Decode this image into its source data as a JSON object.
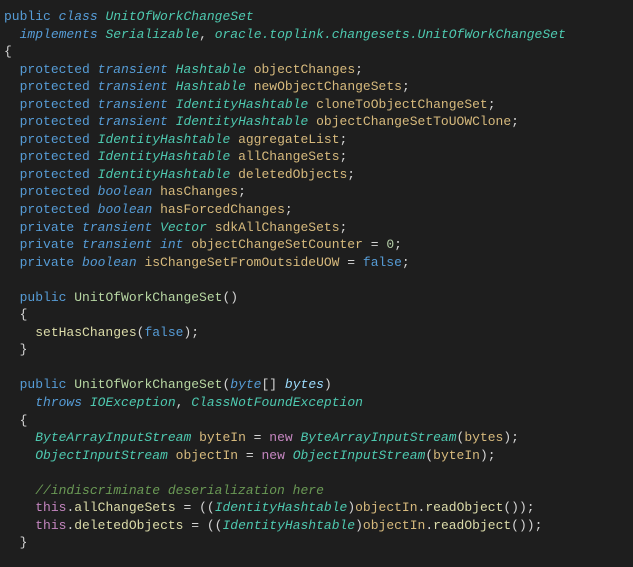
{
  "code": {
    "line01": {
      "kw_public": "public",
      "kw_class": "class",
      "name": "UnitOfWorkChangeSet"
    },
    "line02": {
      "kw_implements": "implements",
      "t1": "Serializable",
      "comma": ",",
      "pkg": "oracle.toplink.changesets.UnitOfWorkChangeSet"
    },
    "line03": {
      "brace": "{"
    },
    "fields": [
      {
        "mod": "protected",
        "trans": "transient",
        "type": "Hashtable",
        "name": "objectChanges",
        "semi": ";"
      },
      {
        "mod": "protected",
        "trans": "transient",
        "type": "Hashtable",
        "name": "newObjectChangeSets",
        "semi": ";"
      },
      {
        "mod": "protected",
        "trans": "transient",
        "type": "IdentityHashtable",
        "name": "cloneToObjectChangeSet",
        "semi": ";"
      },
      {
        "mod": "protected",
        "trans": "transient",
        "type": "IdentityHashtable",
        "name": "objectChangeSetToUOWClone",
        "semi": ";"
      },
      {
        "mod": "protected",
        "trans": "",
        "type": "IdentityHashtable",
        "name": "aggregateList",
        "semi": ";"
      },
      {
        "mod": "protected",
        "trans": "",
        "type": "IdentityHashtable",
        "name": "allChangeSets",
        "semi": ";"
      },
      {
        "mod": "protected",
        "trans": "",
        "type": "IdentityHashtable",
        "name": "deletedObjects",
        "semi": ";"
      },
      {
        "mod": "protected",
        "trans": "",
        "type": "boolean",
        "name": "hasChanges",
        "semi": ";"
      },
      {
        "mod": "protected",
        "trans": "",
        "type": "boolean",
        "name": "hasForcedChanges",
        "semi": ";"
      },
      {
        "mod": "private",
        "trans": "transient",
        "type": "Vector",
        "name": "sdkAllChangeSets",
        "semi": ";"
      },
      {
        "mod": "private",
        "trans": "transient",
        "type": "int",
        "name": "objectChangeSetCounter",
        "eq": " = ",
        "val": "0",
        "semi": ";"
      },
      {
        "mod": "private",
        "trans": "",
        "type": "boolean",
        "name": "isChangeSetFromOutsideUOW",
        "eq": " = ",
        "val": "false",
        "semi": ";"
      }
    ],
    "ctor1": {
      "mod": "public",
      "name": "UnitOfWorkChangeSet",
      "parens": "()",
      "body_call": "setHasChanges",
      "lp": "(",
      "arg": "false",
      "rp": ")",
      "semi": ";"
    },
    "ctor2": {
      "mod": "public",
      "name": "UnitOfWorkChangeSet",
      "lp": "(",
      "ptype": "byte",
      "arr": "[]",
      "pname": "bytes",
      "rp": ")",
      "kw_throws": "throws",
      "ex1": "IOException",
      "comma": ",",
      "ex2": "ClassNotFoundException",
      "l1": {
        "type": "ByteArrayInputStream",
        "var": "byteIn",
        "eq": " = ",
        "kw_new": "new",
        "ctype": "ByteArrayInputStream",
        "lp": "(",
        "arg": "bytes",
        "rp": ")",
        "semi": ";"
      },
      "l2": {
        "type": "ObjectInputStream",
        "var": "objectIn",
        "eq": " = ",
        "kw_new": "new",
        "ctype": "ObjectInputStream",
        "lp": "(",
        "arg": "byteIn",
        "rp": ")",
        "semi": ";"
      },
      "comment": "//indiscriminate deserialization here",
      "l3": {
        "this": "this",
        "dot": ".",
        "field": "allChangeSets",
        "eq": " = ((",
        "cast": "IdentityHashtable",
        "mid": ")",
        "obj": "objectIn",
        "dot2": ".",
        "meth": "readObject",
        "paren": "())",
        "semi": ";"
      },
      "l4": {
        "this": "this",
        "dot": ".",
        "field": "deletedObjects",
        "eq": " = ((",
        "cast": "IdentityHashtable",
        "mid": ")",
        "obj": "objectIn",
        "dot2": ".",
        "meth": "readObject",
        "paren": "())",
        "semi": ";"
      }
    }
  }
}
